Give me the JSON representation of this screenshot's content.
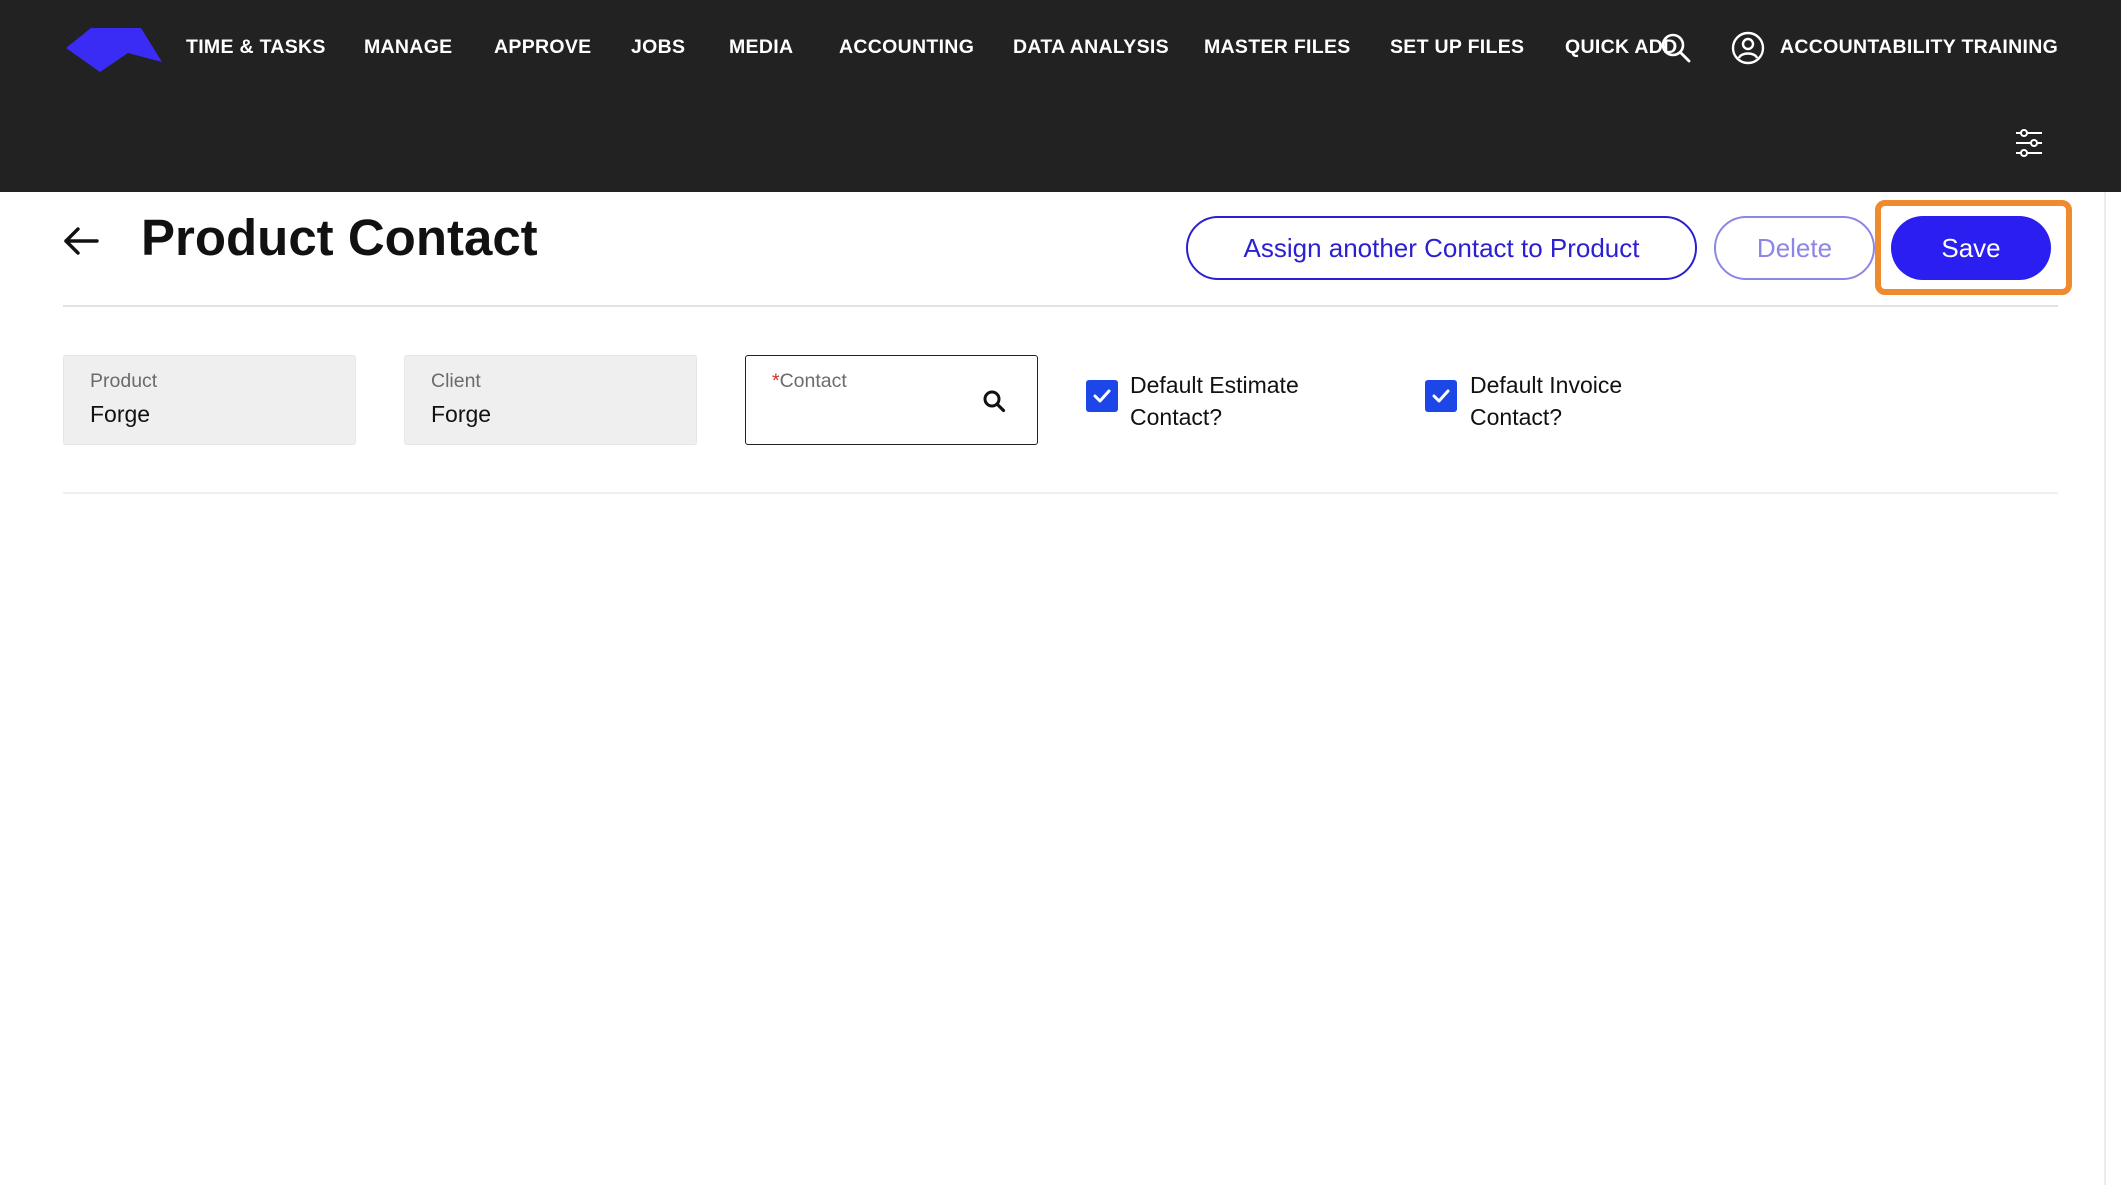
{
  "nav": {
    "items": [
      {
        "label": "TIME & TASKS"
      },
      {
        "label": "MANAGE"
      },
      {
        "label": "APPROVE"
      },
      {
        "label": "JOBS"
      },
      {
        "label": "MEDIA"
      },
      {
        "label": "ACCOUNTING"
      },
      {
        "label": "DATA ANALYSIS"
      },
      {
        "label": "MASTER FILES"
      },
      {
        "label": "SET UP FILES"
      },
      {
        "label": "QUICK ADD"
      }
    ],
    "user_name": "ACCOUNTABILITY TRAINING",
    "icons": {
      "logo": "brand-logo",
      "search": "search-icon",
      "user": "user-circle-icon",
      "filter": "sliders-icon"
    }
  },
  "header": {
    "title": "Product Contact",
    "back_icon": "arrow-left-icon",
    "assign_label": "Assign another Contact to Product",
    "delete_label": "Delete",
    "save_label": "Save"
  },
  "form": {
    "product": {
      "label": "Product",
      "value": "Forge"
    },
    "client": {
      "label": "Client",
      "value": "Forge"
    },
    "contact": {
      "required_mark": "*",
      "label": "Contact",
      "value": "",
      "search_icon": "search-icon"
    },
    "default_estimate": {
      "label": "Default Estimate Contact?",
      "checked": true
    },
    "default_invoice": {
      "label": "Default Invoice Contact?",
      "checked": true
    }
  },
  "colors": {
    "nav_bg": "#222222",
    "accent": "#2a1ff0",
    "checkbox": "#1c46e8",
    "highlight": "#ef8a2e",
    "required": "#d0342c"
  }
}
